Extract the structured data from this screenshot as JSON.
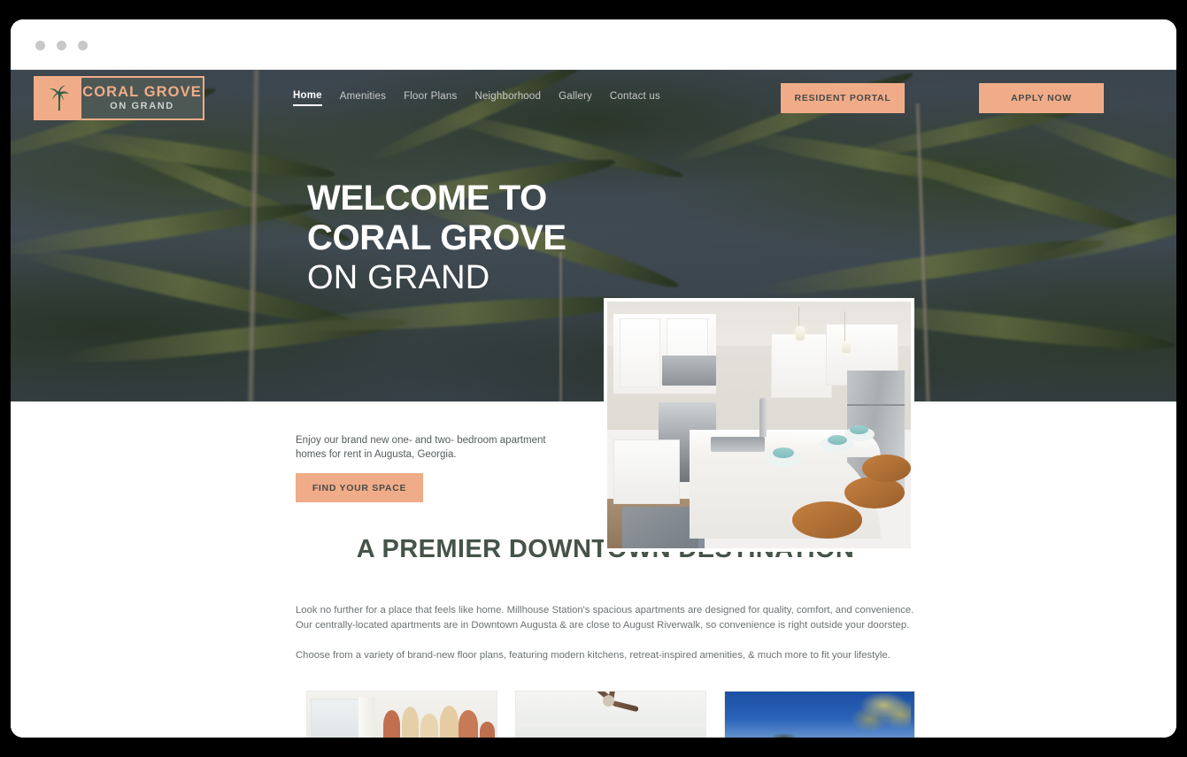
{
  "browser": {
    "dots": [
      "window-dot",
      "window-dot",
      "window-dot"
    ]
  },
  "header": {
    "logo": {
      "icon": "palm-tree-icon",
      "title": "CORAL GROVE",
      "subtitle": "ON GRAND"
    },
    "nav": [
      {
        "label": "Home",
        "active": true
      },
      {
        "label": "Amenities",
        "active": false
      },
      {
        "label": "Floor Plans",
        "active": false
      },
      {
        "label": "Neighborhood",
        "active": false
      },
      {
        "label": "Gallery",
        "active": false
      },
      {
        "label": "Contact us",
        "active": false
      }
    ],
    "resident_portal_label": "RESIDENT PORTAL",
    "apply_now_label": "APPLY NOW"
  },
  "hero": {
    "line1": "WELCOME TO",
    "line2": "CORAL GROVE",
    "line3": "ON GRAND",
    "image_alt": "kitchen-photo"
  },
  "intro": {
    "lead": "Enjoy our brand new one- and two- bedroom apartment homes for rent in Augusta, Georgia.",
    "cta_label": "FIND YOUR SPACE",
    "section_title": "A PREMIER DOWNTOWN DESTINATION",
    "paragraph1": "Look no further for a place that feels like home. Millhouse Station's spacious apartments are designed for quality, comfort, and convenience. Our centrally-located apartments are in Downtown Augusta & are close to August Riverwalk, so convenience is right outside your doorstep.",
    "paragraph2": "Choose from a variety of brand-new floor plans, featuring modern kitchens, retreat-inspired amenities, & much more to fit your lifestyle."
  },
  "gallery": [
    {
      "alt": "living-room-with-arch-mural-photo"
    },
    {
      "alt": "bedroom-ceiling-fan-photo"
    },
    {
      "alt": "palm-tree-blue-sky-photo"
    }
  ],
  "colors": {
    "peach": "#f0ac88",
    "dark_green": "#455349",
    "logo_box": "#4d5855",
    "body_text": "#6c7173",
    "hero_sky": "#49545e"
  }
}
